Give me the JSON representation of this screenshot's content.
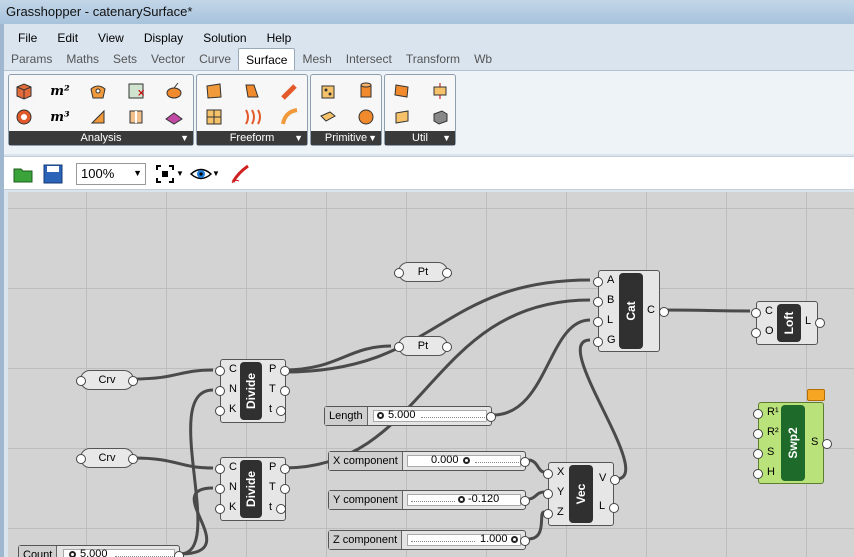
{
  "window": {
    "title": "Grasshopper - catenarySurface*"
  },
  "menu": [
    "File",
    "Edit",
    "View",
    "Display",
    "Solution",
    "Help"
  ],
  "tabs": [
    "Params",
    "Maths",
    "Sets",
    "Vector",
    "Curve",
    "Surface",
    "Mesh",
    "Intersect",
    "Transform",
    "Wb"
  ],
  "active_tab": "Surface",
  "ribbon": {
    "panels": [
      {
        "label": "Analysis",
        "icons": [
          "box-icon",
          "area-m2-icon",
          "surface-point-icon",
          "closest-point-icon",
          "evaluate-icon",
          "mass-icon",
          "volume-m3-icon",
          "dimensions-icon",
          "brep-icon",
          "shape-icon"
        ]
      },
      {
        "label": "Freeform",
        "icons": [
          "four-point-icon",
          "extrude-icon",
          "pipe-icon",
          "network-icon",
          "sweep-icon",
          "rail-icon"
        ]
      },
      {
        "label": "Primitive",
        "icons": [
          "cube-icon",
          "cylinder-icon",
          "plane-icon",
          "sphere-icon"
        ]
      },
      {
        "label": "Util",
        "icons": [
          "copy-trim-icon",
          "divide-domain-icon",
          "isotrim-icon",
          "box-morph-icon"
        ]
      }
    ]
  },
  "toolbar": {
    "zoom": "100%"
  },
  "canvas": {
    "params": [
      {
        "id": "pt1",
        "label": "Pt"
      },
      {
        "id": "pt2",
        "label": "Pt"
      },
      {
        "id": "crv1",
        "label": "Crv"
      },
      {
        "id": "crv2",
        "label": "Crv"
      }
    ],
    "components": {
      "divide1": {
        "name": "Divide",
        "inputs": [
          "C",
          "N",
          "K"
        ],
        "outputs": [
          "P",
          "T",
          "t"
        ]
      },
      "divide2": {
        "name": "Divide",
        "inputs": [
          "C",
          "N",
          "K"
        ],
        "outputs": [
          "P",
          "T",
          "t"
        ]
      },
      "cat": {
        "name": "Cat",
        "inputs": [
          "A",
          "B",
          "L",
          "G"
        ],
        "outputs": [
          "C"
        ]
      },
      "loft": {
        "name": "Loft",
        "inputs": [
          "C",
          "O"
        ],
        "outputs": [
          "L"
        ]
      },
      "vec": {
        "name": "Vec",
        "inputs": [
          "X",
          "Y",
          "Z"
        ],
        "outputs": [
          "V",
          "L"
        ]
      },
      "swp2": {
        "name": "Swp2",
        "inputs": [
          "R¹",
          "R²",
          "S",
          "H"
        ],
        "outputs": [
          "S"
        ]
      }
    },
    "sliders": [
      {
        "id": "length",
        "label": "Length",
        "value": "5.000"
      },
      {
        "id": "xcomp",
        "label": "X component",
        "value": "0.000"
      },
      {
        "id": "ycomp",
        "label": "Y component",
        "value": "-0.120"
      },
      {
        "id": "zcomp",
        "label": "Z component",
        "value": "1.000"
      },
      {
        "id": "count",
        "label": "Count",
        "value": "5.000"
      }
    ]
  }
}
